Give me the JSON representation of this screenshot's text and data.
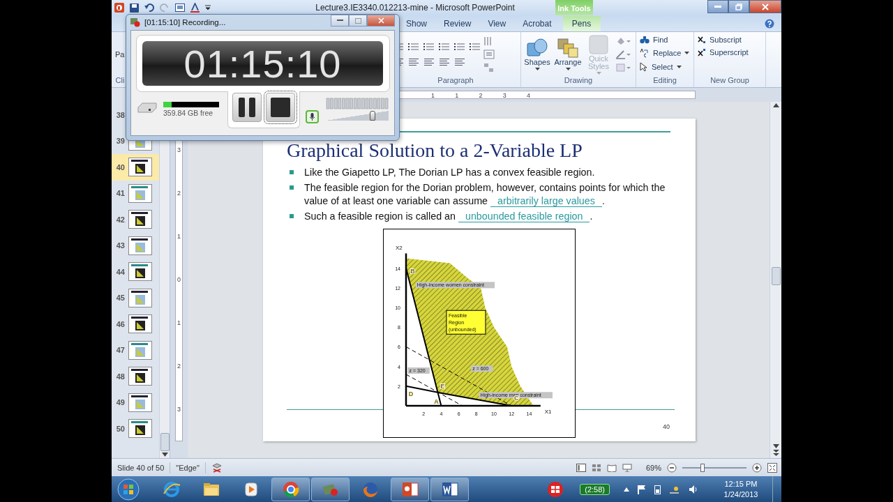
{
  "window": {
    "title": "Lecture3.IE3340.012213-mine  -  Microsoft PowerPoint",
    "context_tab_group": "Ink Tools"
  },
  "ribbon": {
    "tabs": [
      {
        "label": "Show",
        "selected": false,
        "contextual": false
      },
      {
        "label": "Review",
        "selected": false,
        "contextual": false
      },
      {
        "label": "View",
        "selected": false,
        "contextual": false
      },
      {
        "label": "Acrobat",
        "selected": false,
        "contextual": false
      },
      {
        "label": "Pens",
        "selected": false,
        "contextual": true
      }
    ],
    "partial": {
      "button": "Pa",
      "group": "Cli"
    },
    "groups": [
      {
        "label": "Paragraph",
        "kind": "paragraph"
      },
      {
        "label": "Drawing",
        "kind": "drawing",
        "buttons": [
          {
            "label": "Shapes",
            "disabled": false
          },
          {
            "label": "Arrange",
            "disabled": false
          },
          {
            "label": "Quick Styles",
            "disabled": true
          }
        ]
      },
      {
        "label": "Editing",
        "kind": "editing",
        "buttons": [
          {
            "label": "Find",
            "dropdown": false
          },
          {
            "label": "Replace",
            "dropdown": true
          },
          {
            "label": "Select",
            "dropdown": true
          }
        ]
      },
      {
        "label": "New Group",
        "kind": "script",
        "buttons": [
          {
            "label": "Subscript"
          },
          {
            "label": "Superscript"
          }
        ]
      }
    ]
  },
  "slides": {
    "thumbnails": [
      {
        "number": "38",
        "selected": false
      },
      {
        "number": "39",
        "selected": false
      },
      {
        "number": "40",
        "selected": true
      },
      {
        "number": "41",
        "selected": false
      },
      {
        "number": "42",
        "selected": false
      },
      {
        "number": "43",
        "selected": false
      },
      {
        "number": "44",
        "selected": false
      },
      {
        "number": "45",
        "selected": false
      },
      {
        "number": "46",
        "selected": false
      },
      {
        "number": "47",
        "selected": false
      },
      {
        "number": "48",
        "selected": false
      },
      {
        "number": "49",
        "selected": false
      },
      {
        "number": "50",
        "selected": false
      }
    ]
  },
  "rulers": {
    "horizontal": [
      "1",
      "1",
      "2",
      "3",
      "4"
    ],
    "vertical": [
      "3",
      "2",
      "1",
      "0",
      "1",
      "2",
      "3"
    ]
  },
  "slide": {
    "title": "Graphical Solution to a 2-Variable LP",
    "bullets": [
      [
        {
          "kind": "text",
          "text": "Like the Giapetto LP, The Dorian LP has a convex feasible region."
        }
      ],
      [
        {
          "kind": "text",
          "text": "The feasible region for the Dorian problem, however, contains points for which the value of at least one variable can assume "
        },
        {
          "kind": "blank",
          "text": "arbitrarily large values"
        },
        {
          "kind": "text",
          "text": "."
        }
      ],
      [
        {
          "kind": "text",
          "text": "Such a feasible region is called an "
        },
        {
          "kind": "blank",
          "text": "unbounded feasible region"
        },
        {
          "kind": "text",
          "text": "."
        }
      ]
    ],
    "page_number": "40",
    "chart_data": {
      "type": "line",
      "xlabel": "X1",
      "ylabel": "X2",
      "x": [
        0,
        4,
        6.4,
        12
      ],
      "series": [
        {
          "name": "High-income women constraint",
          "color": "#000000",
          "line_style": "solid",
          "values": [
            14,
            0,
            null,
            null
          ]
        },
        {
          "name": "High-income men constraint",
          "color": "#000000",
          "line_style": "solid",
          "values": [
            2,
            1.3,
            0.9,
            0
          ]
        },
        {
          "name": "z = 320",
          "color": "#000000",
          "line_style": "dashed",
          "values": [
            3.2,
            1.2,
            0,
            null
          ]
        },
        {
          "name": "z = 600",
          "color": "#000000",
          "line_style": "dashed",
          "values": [
            6,
            4,
            2.8,
            0
          ]
        }
      ],
      "xlim": [
        0,
        15.3
      ],
      "ylim": [
        0,
        15.5
      ],
      "xticks": [
        2,
        4,
        6,
        8,
        10,
        12,
        14
      ],
      "yticks": [
        2,
        4,
        6,
        8,
        10,
        12,
        14
      ],
      "annotations": [
        "Feasible Region (unbounded)",
        "B",
        "E",
        "A",
        "D",
        "C"
      ]
    }
  },
  "recorder": {
    "title": "[01:15:10] Recording...",
    "time": "01:15:10",
    "disk": {
      "text": "359.84 GB free",
      "level": 0.15
    },
    "buttons": [
      {
        "kind": "pause",
        "focused": false
      },
      {
        "kind": "stop",
        "focused": true
      }
    ],
    "volume": {
      "level": 0.74
    }
  },
  "status_bar": {
    "slide": "Slide 40 of 50",
    "theme": "\"Edge\"",
    "zoom": "69%",
    "zoom_slider": {
      "level": 0.32
    }
  },
  "taskbar": {
    "apps": [
      {
        "kind": "browser",
        "running": false
      },
      {
        "kind": "folder",
        "running": false
      },
      {
        "kind": "media",
        "running": false
      },
      {
        "kind": "chrome",
        "running": true
      },
      {
        "kind": "recorder",
        "running": true
      },
      {
        "kind": "firefox",
        "running": false
      },
      {
        "kind": "powerpoint",
        "running": true
      },
      {
        "kind": "word",
        "running": true
      }
    ],
    "battery": "(2:58)",
    "time": "12:15 PM",
    "date": "1/24/2013"
  }
}
